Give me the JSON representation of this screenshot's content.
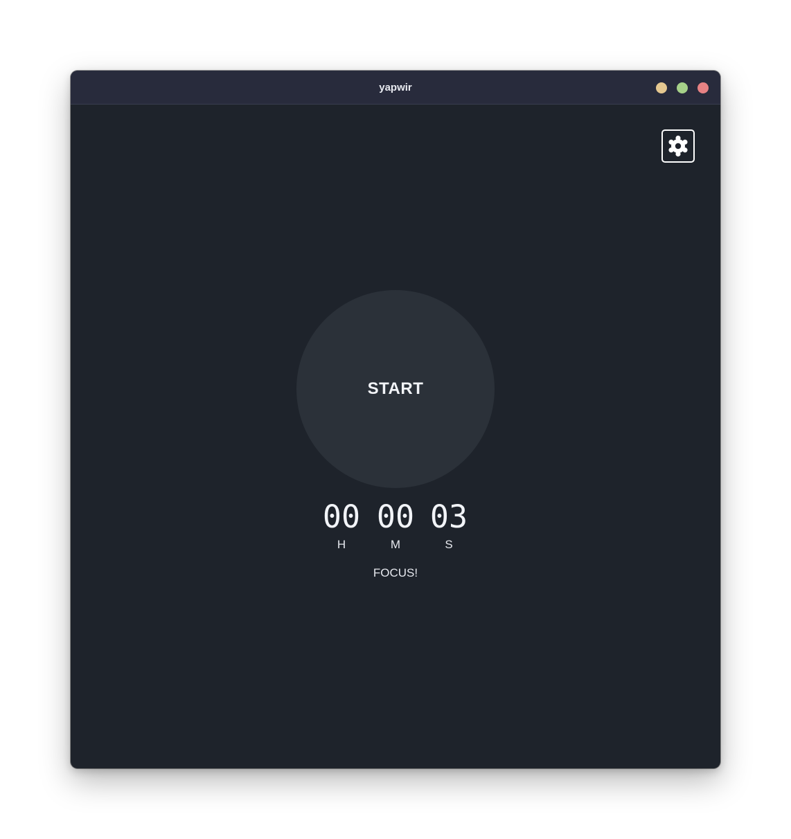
{
  "window": {
    "title": "yapwir",
    "controls": [
      {
        "name": "minimize",
        "color": "#e5c890"
      },
      {
        "name": "maximize",
        "color": "#a6d189"
      },
      {
        "name": "close",
        "color": "#e78284"
      }
    ]
  },
  "settings": {
    "icon": "gear-icon"
  },
  "timer": {
    "button_label": "START",
    "hours": "00",
    "minutes": "00",
    "seconds": "03",
    "hours_unit": "H",
    "minutes_unit": "M",
    "seconds_unit": "S",
    "status": "FOCUS!"
  },
  "colors": {
    "background": "#1e232b",
    "titlebar": "#282b3c",
    "button": "#2b3139",
    "text": "#f2f4f8"
  }
}
